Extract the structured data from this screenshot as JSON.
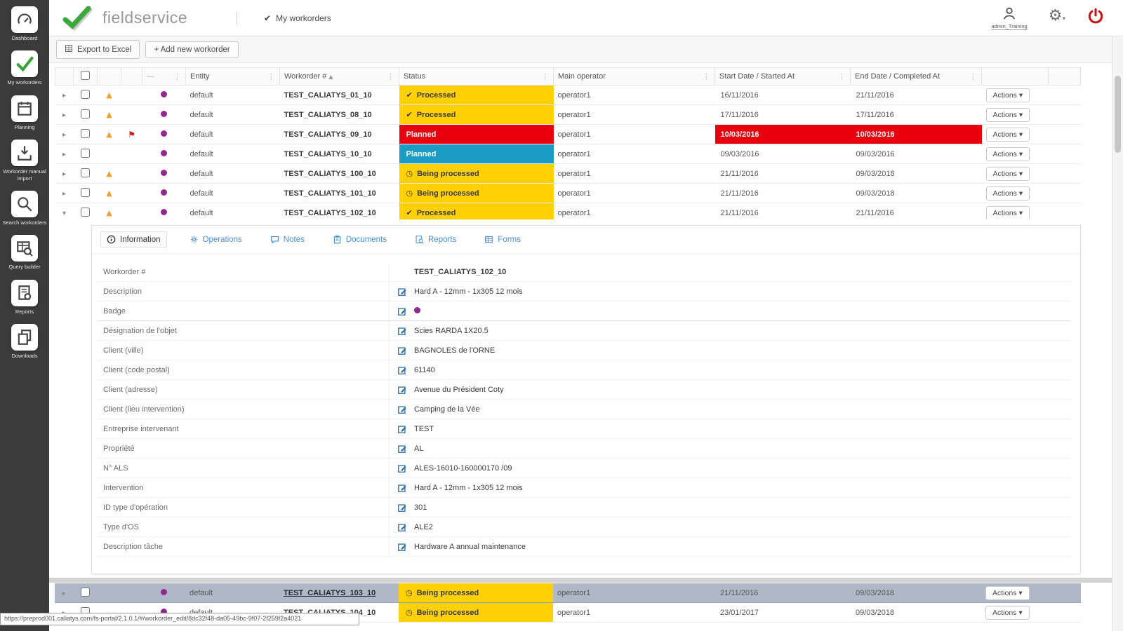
{
  "header": {
    "brand": "fieldservice",
    "workorders_label": "My workorders",
    "user_name": "admin_Training"
  },
  "icons": {
    "column_menu": "⋮",
    "sort": "▲",
    "dash": "—",
    "warning": "▲",
    "flag": "⚑",
    "gear": "⚙",
    "caret_down": "▾",
    "nav_check": "✔"
  },
  "sidebar": {
    "items": [
      {
        "name": "dashboard",
        "label": "Dashboard",
        "icon": "dashboard-icon",
        "active": false
      },
      {
        "name": "my-workorders",
        "label": "My workorders",
        "icon": "check-icon",
        "active": true
      },
      {
        "name": "planning",
        "label": "Planning",
        "icon": "calendar-icon",
        "active": false
      },
      {
        "name": "workorder-manual-import",
        "label": "Workorder manual import",
        "icon": "import-icon",
        "active": false
      },
      {
        "name": "search-workorders",
        "label": "Search workorders",
        "icon": "search-icon",
        "active": false
      },
      {
        "name": "query-builder",
        "label": "Query builder",
        "icon": "table-search-icon",
        "active": false
      },
      {
        "name": "reports",
        "label": "Reports",
        "icon": "report-icon",
        "active": false
      },
      {
        "name": "downloads",
        "label": "Downloads",
        "icon": "downloads-icon",
        "active": false
      }
    ]
  },
  "toolbar": {
    "export_label": "Export to Excel",
    "add_label": "+ Add new workorder"
  },
  "table": {
    "headers": {
      "entity": "Entity",
      "workorder": "Workorder #",
      "status": "Status",
      "operator": "Main operator",
      "start": "Start Date / Started At",
      "end": "End Date / Completed At"
    },
    "rows": [
      {
        "expand": "▸",
        "warning": true,
        "flag": false,
        "badge": "#92278f",
        "entity": "default",
        "workorder": "TEST_CALIATYS_01_10",
        "status": "Processed",
        "status_icon": "✔",
        "status_kind": "processed",
        "operator": "operator1",
        "start": "16/11/2016",
        "end": "21/11/2016",
        "dates_alert": false,
        "actions": "Actions ▾"
      },
      {
        "expand": "▸",
        "warning": true,
        "flag": false,
        "badge": "#92278f",
        "entity": "default",
        "workorder": "TEST_CALIATYS_08_10",
        "status": "Processed",
        "status_icon": "✔",
        "status_kind": "processed",
        "operator": "operator1",
        "start": "17/11/2016",
        "end": "17/11/2016",
        "dates_alert": false,
        "actions": "Actions ▾"
      },
      {
        "expand": "▸",
        "warning": true,
        "flag": true,
        "badge": "#92278f",
        "entity": "default",
        "workorder": "TEST_CALIATYS_09_10",
        "status": "Planned",
        "status_icon": "",
        "status_kind": "planned-red",
        "operator": "operator1",
        "start": "10/03/2016",
        "end": "10/03/2016",
        "dates_alert": true,
        "actions": "Actions ▾"
      },
      {
        "expand": "▸",
        "warning": false,
        "flag": false,
        "badge": "#92278f",
        "entity": "default",
        "workorder": "TEST_CALIATYS_10_10",
        "status": "Planned",
        "status_icon": "",
        "status_kind": "planned-blue",
        "operator": "operator1",
        "start": "09/03/2016",
        "end": "09/03/2016",
        "dates_alert": false,
        "actions": "Actions ▾"
      },
      {
        "expand": "▸",
        "warning": true,
        "flag": false,
        "badge": "#92278f",
        "entity": "default",
        "workorder": "TEST_CALIATYS_100_10",
        "status": "Being processed",
        "status_icon": "◷",
        "status_kind": "being",
        "operator": "operator1",
        "start": "21/11/2016",
        "end": "09/03/2018",
        "dates_alert": false,
        "actions": "Actions ▾"
      },
      {
        "expand": "▸",
        "warning": true,
        "flag": false,
        "badge": "#92278f",
        "entity": "default",
        "workorder": "TEST_CALIATYS_101_10",
        "status": "Being processed",
        "status_icon": "◷",
        "status_kind": "being",
        "operator": "operator1",
        "start": "21/11/2016",
        "end": "09/03/2018",
        "dates_alert": false,
        "actions": "Actions ▾"
      },
      {
        "expand": "▾",
        "warning": true,
        "flag": false,
        "badge": "#92278f",
        "entity": "default",
        "workorder": "TEST_CALIATYS_102_10",
        "status": "Processed",
        "status_icon": "✔",
        "status_kind": "processed",
        "operator": "operator1",
        "start": "21/11/2016",
        "end": "21/11/2016",
        "dates_alert": false,
        "actions": "Actions ▾"
      }
    ]
  },
  "detail": {
    "tabs": [
      {
        "label": "Information",
        "icon": "info-icon",
        "active": true
      },
      {
        "label": "Operations",
        "icon": "operations-icon",
        "active": false
      },
      {
        "label": "Notes",
        "icon": "notes-icon",
        "active": false
      },
      {
        "label": "Documents",
        "icon": "documents-icon",
        "active": false
      },
      {
        "label": "Reports",
        "icon": "reports-icon",
        "active": false
      },
      {
        "label": "Forms",
        "icon": "forms-icon",
        "active": false
      }
    ],
    "fields": [
      {
        "label": "Workorder #",
        "value": "TEST_CALIATYS_102_10",
        "editable": false,
        "bold": true
      },
      {
        "label": "Description",
        "value": "Hard A - 12mm - 1x305 12 mois",
        "editable": true
      },
      {
        "label": "Badge",
        "value": "",
        "badge": "#92278f",
        "editable": true,
        "divider_after": true
      },
      {
        "label": "Désignation de l'objet",
        "value": "Scies RARDA 1X20.5",
        "editable": true
      },
      {
        "label": "Client (ville)",
        "value": "BAGNOLES de l'ORNE",
        "editable": true
      },
      {
        "label": "Client (code postal)",
        "value": "61140",
        "editable": true
      },
      {
        "label": "Client (adresse)",
        "value": "Avenue du Président Coty",
        "editable": true
      },
      {
        "label": "Client (lieu intervention)",
        "value": "Camping de la Vée",
        "editable": true
      },
      {
        "label": "Entreprise intervenant",
        "value": "TEST",
        "editable": true
      },
      {
        "label": "Propriété",
        "value": "AL",
        "editable": true
      },
      {
        "label": "N° ALS",
        "value": "ALES-16010-160000170 /09",
        "editable": true
      },
      {
        "label": "Intervention",
        "value": "Hard A - 12mm - 1x305 12 mois",
        "editable": true
      },
      {
        "label": "ID type d'opération",
        "value": "301",
        "editable": true
      },
      {
        "label": "Type d'OS",
        "value": "ALE2",
        "editable": true
      },
      {
        "label": "Description tâche",
        "value": "Hardware A annual maintenance",
        "editable": true
      }
    ]
  },
  "bottom_rows": [
    {
      "expand": "▸",
      "warning": false,
      "flag": false,
      "badge": "#92278f",
      "entity": "default",
      "workorder": "TEST_CALIATYS_103_10",
      "status": "Being processed",
      "status_icon": "◷",
      "status_kind": "being",
      "operator": "operator1",
      "start": "21/11/2016",
      "end": "09/03/2018",
      "dates_alert": false,
      "actions": "Actions ▾",
      "selected": true
    },
    {
      "expand": "▸",
      "warning": false,
      "flag": false,
      "badge": "#92278f",
      "entity": "default",
      "workorder": "TEST_CALIATYS_104_10",
      "status": "Being processed",
      "status_icon": "◷",
      "status_kind": "being",
      "operator": "operator1",
      "start": "23/01/2017",
      "end": "09/03/2018",
      "dates_alert": false,
      "actions": "Actions ▾",
      "selected": false
    }
  ],
  "statusbar": {
    "url": "https://preprod001.caliatys.com/fs-portal/2.1.0.1/#/workorder_edit/8dc32f48-da05-49bc-9f07-2f259f2a4021"
  }
}
